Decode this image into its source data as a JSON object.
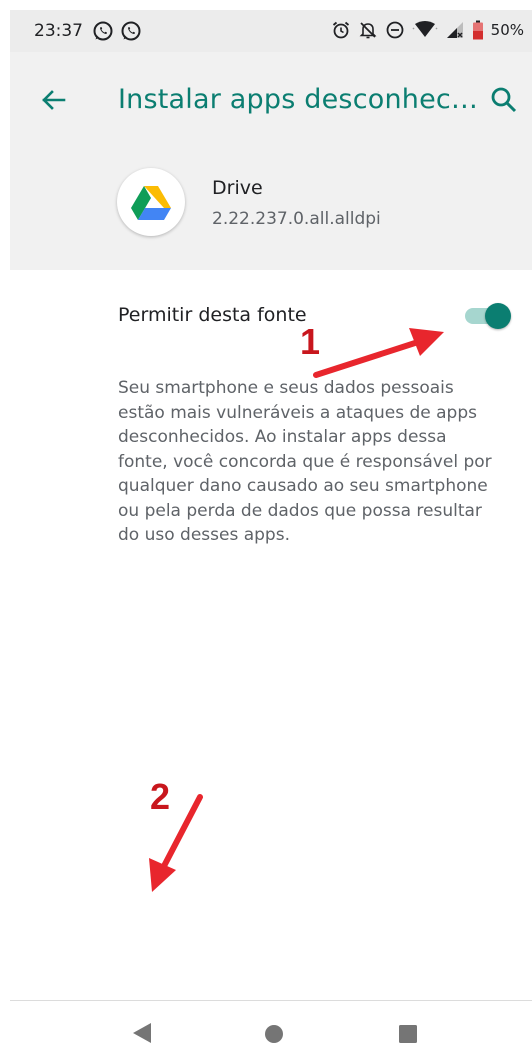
{
  "status_bar": {
    "time": "23:37",
    "battery": "50%",
    "left_icons": [
      "whatsapp-icon",
      "whatsapp-icon"
    ],
    "right_icons": [
      "alarm-icon",
      "notifications-off-icon",
      "do-not-disturb-icon",
      "wifi-icon",
      "cell-signal-icon",
      "battery-icon"
    ]
  },
  "app_bar": {
    "title": "Instalar apps desconhec…",
    "back_icon": "arrow-back-icon",
    "search_icon": "search-icon"
  },
  "app": {
    "name": "Drive",
    "version": "2.22.237.0.all.alldpi",
    "icon": "google-drive-icon"
  },
  "setting": {
    "label": "Permitir desta fonte",
    "enabled": true
  },
  "description": "Seu smartphone e seus dados pessoais\nestão mais vulneráveis a ataques de apps\ndesconhecidos. Ao instalar apps dessa\nfonte, você concorda que é responsável por\nqualquer dano causado ao seu smartphone\nou pela perda de dados que possa resultar\ndo uso desses apps.",
  "annotations": {
    "first": "1",
    "second": "2"
  },
  "colors": {
    "accent": "#0b7e71",
    "toggle_track": "#a6d6cf",
    "annotation": "#c8161d",
    "header_bg": "#f1f1f1"
  },
  "nav_bar": {
    "icons": [
      "nav-back-icon",
      "nav-home-icon",
      "nav-recents-icon"
    ]
  }
}
